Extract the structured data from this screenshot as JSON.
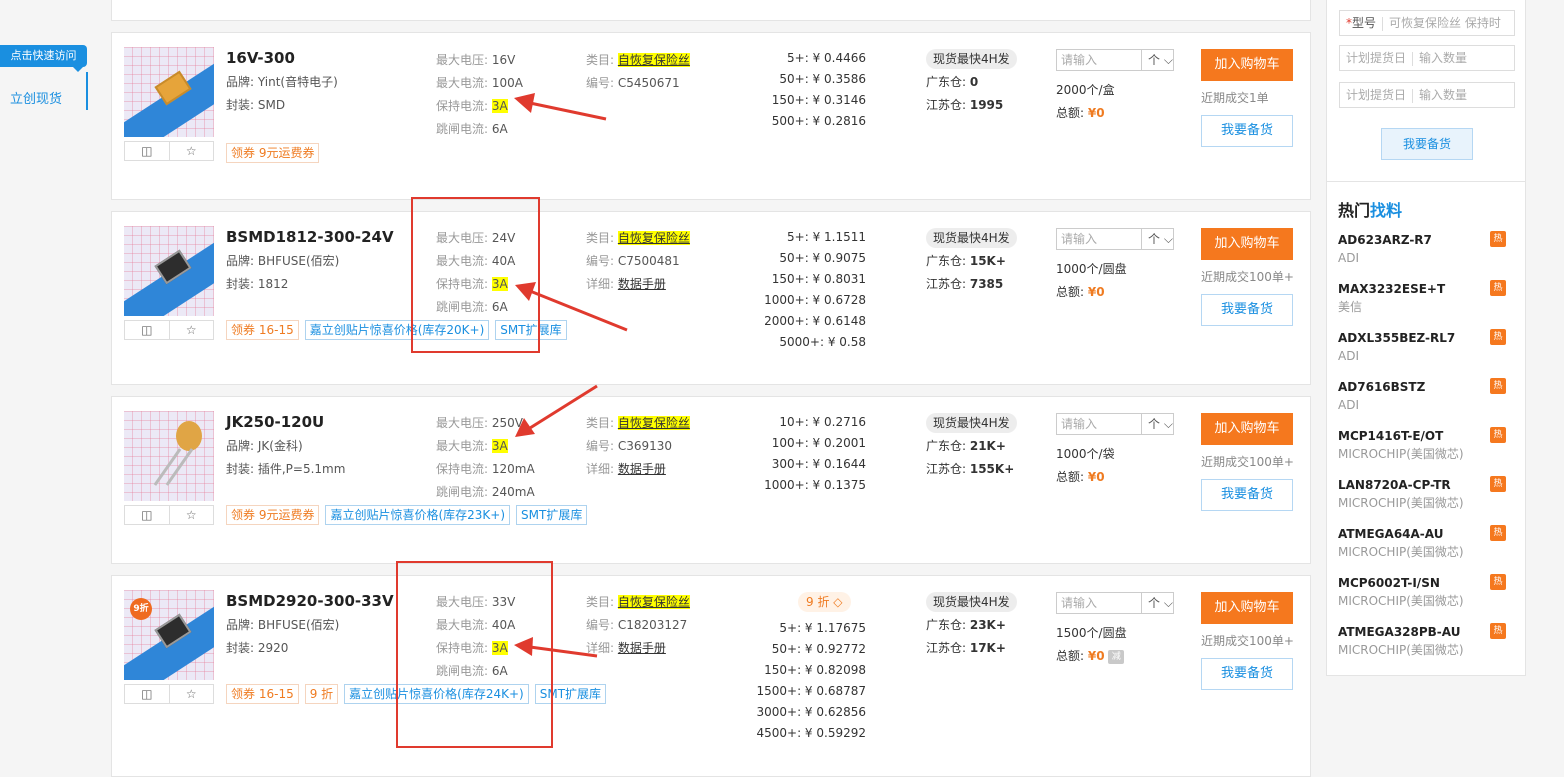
{
  "leftnav": {
    "quick_visit": "点击快速访问",
    "lichuang": "立创现货"
  },
  "labels": {
    "brand": "品牌: ",
    "package": "封装: ",
    "max_voltage": "最大电压: ",
    "max_current": "最大电流: ",
    "hold_current": "保持电流: ",
    "trip_current": "跳闸电流: ",
    "category": "类目: ",
    "code": "编号: ",
    "detail": "详细: ",
    "guangdong": "广东仓: ",
    "jiangsu": "江苏仓: ",
    "total": "总额: ",
    "add_cart": "加入购物车",
    "stockup": "我要备货",
    "qty_placeholder": "请输入",
    "unit": "个",
    "coupon_prefix": "领券",
    "fast_ship": "现货最快4H发"
  },
  "products": [
    {
      "name": "16V-300",
      "brand": "Yint(音特电子)",
      "package": "SMD",
      "max_voltage": "16V",
      "max_current": "100A",
      "hold_current": "3A",
      "trip_current": "6A",
      "category": "自恢复保险丝",
      "code": "C5450671",
      "datasheet": "",
      "coupon": "9元运费券",
      "prices": [
        "5+: ¥ 0.4466",
        "50+: ¥ 0.3586",
        "150+: ¥ 0.3146",
        "500+: ¥ 0.2816"
      ],
      "gd": "0",
      "js": "1995",
      "pack": "2000个/盒",
      "total": "¥0",
      "recent": "近期成交1单"
    },
    {
      "name": "BSMD1812-300-24V",
      "brand": "BHFUSE(佰宏)",
      "package": "1812",
      "max_voltage": "24V",
      "max_current": "40A",
      "hold_current": "3A",
      "trip_current": "6A",
      "category": "自恢复保险丝",
      "code": "C7500481",
      "datasheet": "数据手册",
      "coupon": "16-15",
      "tag1": "嘉立创贴片惊喜价格(库存20K+)",
      "tag2": "SMT扩展库",
      "prices": [
        "5+: ¥ 1.1511",
        "50+: ¥ 0.9075",
        "150+: ¥ 0.8031",
        "1000+: ¥ 0.6728",
        "2000+: ¥ 0.6148",
        "5000+: ¥ 0.58"
      ],
      "gd": "15K+",
      "js": "7385",
      "pack": "1000个/圆盘",
      "total": "¥0",
      "recent": "近期成交100单+"
    },
    {
      "name": "JK250-120U",
      "brand": "JK(金科)",
      "package": "插件,P=5.1mm",
      "max_voltage": "250V",
      "max_current": "3A",
      "hold_current": "120mA",
      "trip_current": "240mA",
      "category": "自恢复保险丝",
      "code": "C369130",
      "datasheet": "数据手册",
      "coupon": "9元运费券",
      "tag1": "嘉立创贴片惊喜价格(库存23K+)",
      "tag2": "SMT扩展库",
      "prices": [
        "10+: ¥ 0.2716",
        "100+: ¥ 0.2001",
        "300+: ¥ 0.1644",
        "1000+: ¥ 0.1375"
      ],
      "gd": "21K+",
      "js": "155K+",
      "pack": "1000个/袋",
      "total": "¥0",
      "recent": "近期成交100单+"
    },
    {
      "name": "BSMD2920-300-33V",
      "brand": "BHFUSE(佰宏)",
      "package": "2920",
      "max_voltage": "33V",
      "max_current": "40A",
      "hold_current": "3A",
      "trip_current": "6A",
      "category": "自恢复保险丝",
      "code": "C18203127",
      "datasheet": "数据手册",
      "coupon": "16-15",
      "discount": "9 折",
      "thumb_badge": "9折",
      "tag1": "嘉立创贴片惊喜价格(库存24K+)",
      "tag2": "SMT扩展库",
      "prices": [
        "5+: ¥ 1.17675",
        "50+: ¥ 0.92772",
        "150+: ¥ 0.82098",
        "1500+: ¥ 0.68787",
        "3000+: ¥ 0.62856",
        "4500+: ¥ 0.59292"
      ],
      "gd": "23K+",
      "js": "17K+",
      "pack": "1500个/圆盘",
      "total": "¥0",
      "minus": "减",
      "recent": "近期成交100单+"
    }
  ],
  "right_panel": {
    "model_label": "型号",
    "model_placeholder": "可恢复保险丝 保持时",
    "date_placeholder": "计划提货日",
    "qty_placeholder": "输入数量",
    "stock_button": "我要备货",
    "hot_title_a": "热门",
    "hot_title_b": "找料",
    "hot_badge": "热",
    "hot_items": [
      {
        "part": "AD623ARZ-R7",
        "brand": "ADI"
      },
      {
        "part": "MAX3232ESE+T",
        "brand": "美信"
      },
      {
        "part": "ADXL355BEZ-RL7",
        "brand": "ADI"
      },
      {
        "part": "AD7616BSTZ",
        "brand": "ADI"
      },
      {
        "part": "MCP1416T-E/OT",
        "brand": "MICROCHIP(美国微芯)"
      },
      {
        "part": "LAN8720A-CP-TR",
        "brand": "MICROCHIP(美国微芯)"
      },
      {
        "part": "ATMEGA64A-AU",
        "brand": "MICROCHIP(美国微芯)"
      },
      {
        "part": "MCP6002T-I/SN",
        "brand": "MICROCHIP(美国微芯)"
      },
      {
        "part": "ATMEGA328PB-AU",
        "brand": "MICROCHIP(美国微芯)"
      }
    ]
  },
  "colors": {
    "accent": "#1a8fe0",
    "cart": "#f5781e",
    "highlight": "#ffff00",
    "annotation": "#e03a2e"
  }
}
